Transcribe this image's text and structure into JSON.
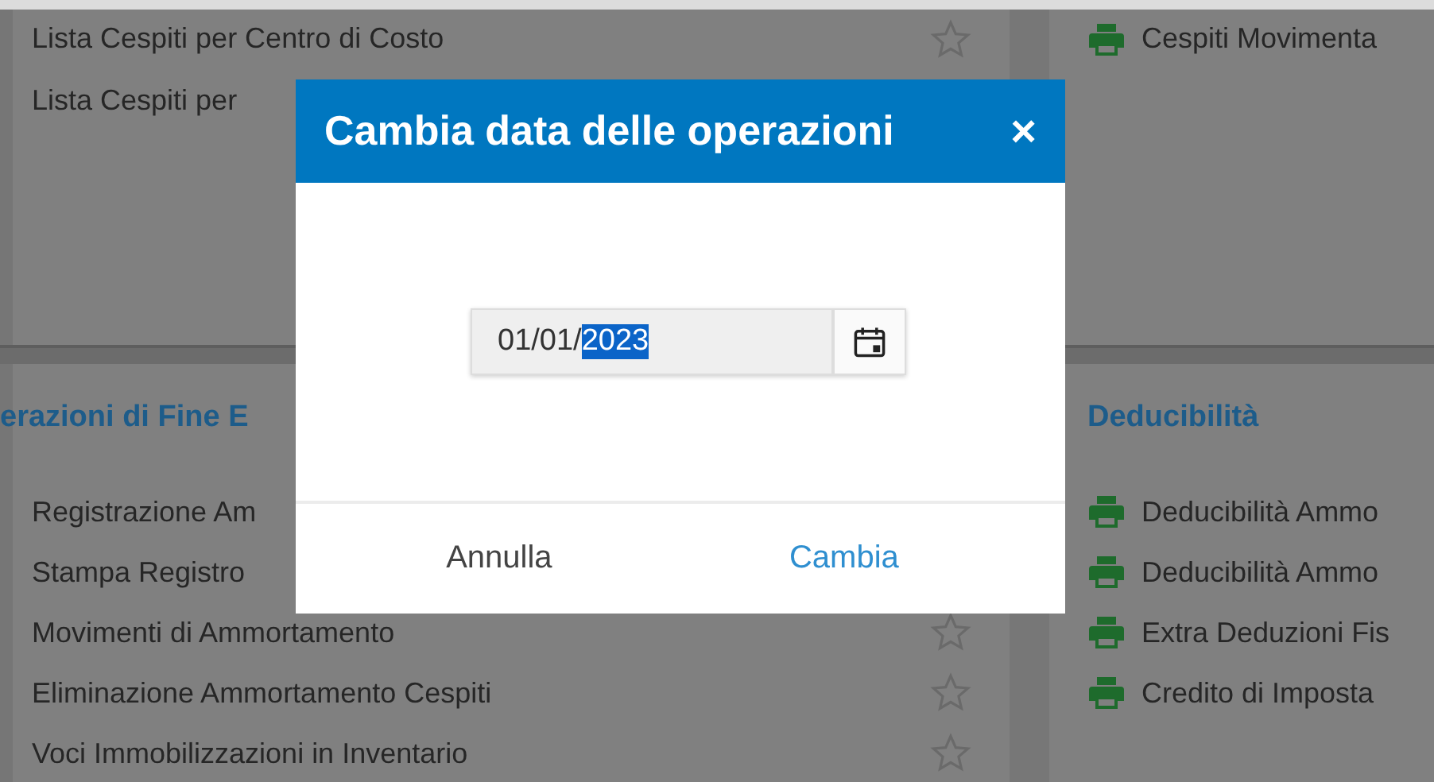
{
  "top_left_list": {
    "items": [
      {
        "label": "Lista Cespiti per Centro di Costo"
      },
      {
        "label": "Lista Cespiti per"
      }
    ]
  },
  "top_right_list": {
    "items": [
      {
        "label": "Cespiti Movimenta"
      }
    ]
  },
  "bottom_left_section": {
    "heading": "erazioni di Fine E",
    "items": [
      {
        "label": "Registrazione Am"
      },
      {
        "label": "Stampa Registro"
      },
      {
        "label": "Movimenti di Ammortamento"
      },
      {
        "label": "Eliminazione Ammortamento Cespiti"
      },
      {
        "label": "Voci Immobilizzazioni in Inventario"
      }
    ]
  },
  "bottom_right_section": {
    "heading": "Deducibilità",
    "items": [
      {
        "label": "Deducibilità Ammo"
      },
      {
        "label": "Deducibilità Ammo"
      },
      {
        "label": "Extra Deduzioni Fis"
      },
      {
        "label": "Credito di Imposta"
      }
    ]
  },
  "dialog": {
    "title": "Cambia data delle operazioni",
    "close": "×",
    "date_field": {
      "value_parts": [
        {
          "text": "01/01/",
          "selected": false
        },
        {
          "text": "2023",
          "selected": true
        }
      ]
    },
    "buttons": [
      {
        "label": "Annulla",
        "kind": "secondary"
      },
      {
        "label": "Cambia",
        "kind": "primary"
      }
    ]
  }
}
